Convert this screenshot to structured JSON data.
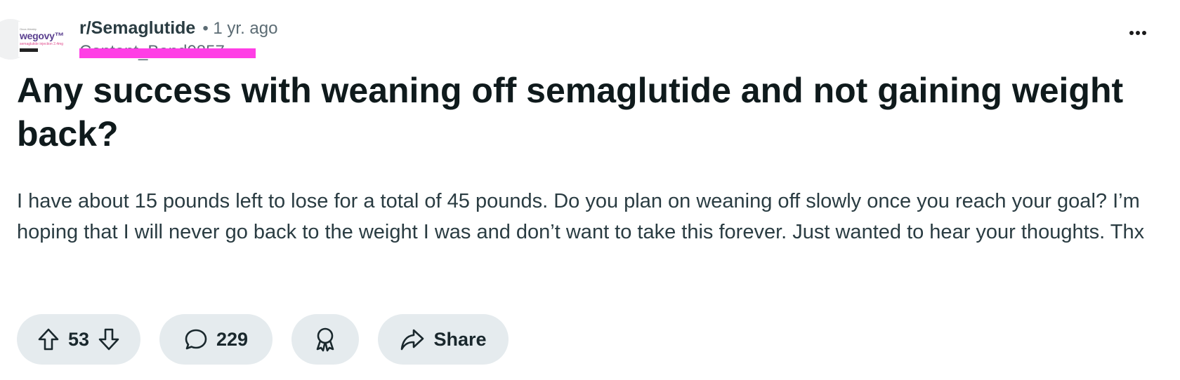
{
  "post": {
    "subreddit": "r/Semaglutide",
    "age": "• 1 yr. ago",
    "username": "Content_Band0857",
    "title": "Any success with weaning off semaglutide and not gaining weight back?",
    "body": "I have about 15 pounds left to lose for a total of 45 pounds. Do you plan on weaning off slowly once you reach your goal? I’m hoping that I will never go back to the weight I was and don’t want to take this forever. Just wanted to hear your thoughts. Thx"
  },
  "avatar": {
    "brand_word": "wegovy™",
    "brand_small": "Once-Weekly",
    "brand_sub": "semaglutide injection 2.4mg"
  },
  "actions": {
    "upvotes": "53",
    "comments": "229",
    "share_label": "Share"
  },
  "icons": {
    "more": "more-options-icon",
    "upvote": "upvote-arrow-icon",
    "downvote": "downvote-arrow-icon",
    "comment": "comment-bubble-icon",
    "award": "award-icon",
    "share": "share-arrow-icon"
  },
  "colors": {
    "pill_background": "#e5ebee",
    "redaction": "#ff3ee5",
    "text": "#1a282d"
  }
}
